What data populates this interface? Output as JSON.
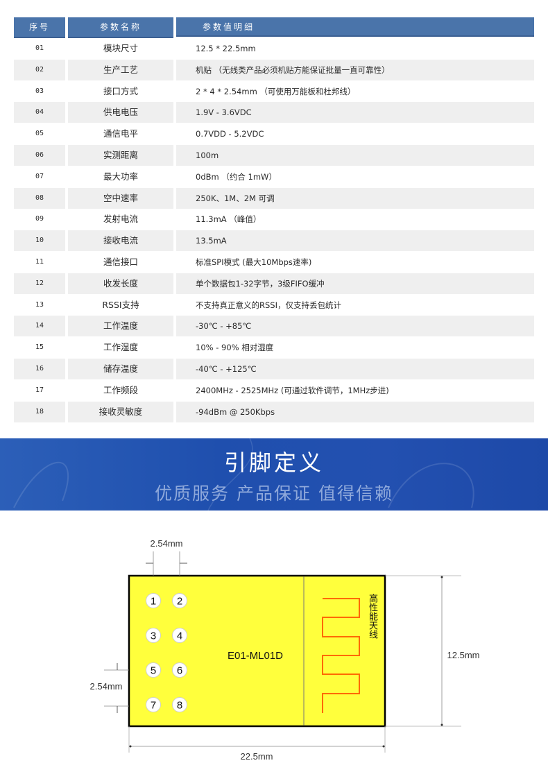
{
  "spec_table": {
    "headers": [
      "序号",
      "参数名称",
      "参数值明细"
    ],
    "rows": [
      {
        "no": "01",
        "name": "模块尺寸",
        "value": "12.5 * 22.5mm"
      },
      {
        "no": "02",
        "name": "生产工艺",
        "value": "机贴 （无线类产品必须机贴方能保证批量一直可靠性）"
      },
      {
        "no": "03",
        "name": "接口方式",
        "value": "2 * 4 * 2.54mm  （可使用万能板和杜邦线）"
      },
      {
        "no": "04",
        "name": "供电电压",
        "value": "1.9V - 3.6VDC"
      },
      {
        "no": "05",
        "name": "通信电平",
        "value": "0.7VDD - 5.2VDC"
      },
      {
        "no": "06",
        "name": "实测距离",
        "value": "100m"
      },
      {
        "no": "07",
        "name": "最大功率",
        "value": "0dBm （约合 1mW）"
      },
      {
        "no": "08",
        "name": "空中速率",
        "value": "250K、1M、2M 可调"
      },
      {
        "no": "09",
        "name": "发射电流",
        "value": "11.3mA （峰值）"
      },
      {
        "no": "10",
        "name": "接收电流",
        "value": "13.5mA"
      },
      {
        "no": "11",
        "name": "通信接口",
        "value": "标准SPI模式 (最大10Mbps速率)"
      },
      {
        "no": "12",
        "name": "收发长度",
        "value": "单个数据包1-32字节，3级FIFO缓冲"
      },
      {
        "no": "13",
        "name": "RSSI支持",
        "value": "不支持真正意义的RSSI，仅支持丢包统计"
      },
      {
        "no": "14",
        "name": "工作温度",
        "value": "-30℃ - +85℃"
      },
      {
        "no": "15",
        "name": "工作湿度",
        "value": "10% - 90% 相对湿度"
      },
      {
        "no": "16",
        "name": "储存温度",
        "value": "-40℃ - +125℃"
      },
      {
        "no": "17",
        "name": "工作频段",
        "value": "2400MHz - 2525MHz (可通过软件调节，1MHz步进)"
      },
      {
        "no": "18",
        "name": "接收灵敏度",
        "value": "-94dBm @ 250Kbps"
      }
    ]
  },
  "banner": {
    "title": "引脚定义",
    "subtitle": "优质服务 产品保证 值得信赖"
  },
  "pin_diagram": {
    "module_name": "E01-ML01D",
    "antenna_label": "高性能天线",
    "pins": [
      "1",
      "2",
      "3",
      "4",
      "5",
      "6",
      "7",
      "8"
    ],
    "dimensions": {
      "pin_pitch_horizontal": "2.54mm",
      "pin_pitch_vertical": "2.54mm",
      "height": "12.5mm",
      "width": "22.5mm"
    },
    "colors": {
      "board": "#ffff3c",
      "antenna": "#ff6a00",
      "header": "#4a74aa",
      "banner": "#1f4fae"
    }
  }
}
